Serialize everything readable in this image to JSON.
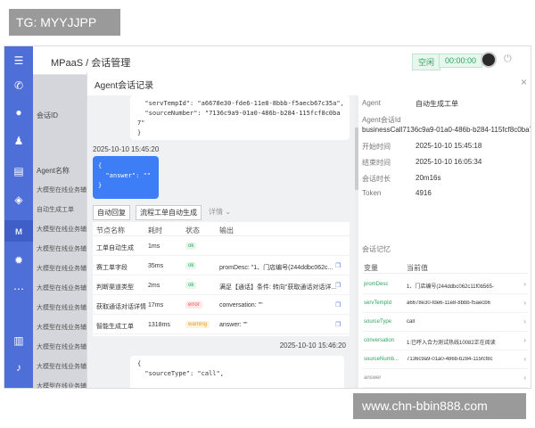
{
  "watermark_tag": "TG: MYYJJPP",
  "watermark_url": "www.chn-bbin888.com",
  "header": {
    "breadcrumb": "MPaaS / 会话管理",
    "status_idle": "空闲",
    "timer": "00:00:00"
  },
  "rail_icons": [
    "menu-icon",
    "phone-icon",
    "chat-icon",
    "user-icon",
    "clipboard-icon",
    "shield-icon",
    "agents-icon",
    "gear-icon",
    "more-icon",
    "book-icon",
    "bell-icon"
  ],
  "bg_list": {
    "title": "Agent名称",
    "rows": [
      "大模型在线业务辅",
      "自动生成工单",
      "大模型在线业务辅",
      "大模型在线业务辅",
      "大模型在线业务辅",
      "大模型在线业务辅",
      "大模型在线业务辅",
      "大模型在线业务辅",
      "大模型在线业务辅",
      "大模型在线业务辅",
      "大模型在线业务辅"
    ],
    "side_label": "会话ID"
  },
  "modal": {
    "title": "Agent会话记录",
    "close": "×"
  },
  "chat": {
    "top_code": "  \"servTempId\": \"a6678e30-fde6-11e8-8bbb-f5aecb67c35a\",\n  \"sourceNumber\": \"7136c9a9-01a0-486b-b284-115fcf8c0ba\n7\"\n}",
    "ts1": "2025-10-10 15:45:20",
    "bubble": "{\n  \"answer\": \"\"\n}",
    "btn_auto_reply": "自动回复",
    "btn_flow": "流程工单自动生成",
    "details": "详情 ⌄",
    "table_head": [
      "节点名称",
      "耗时",
      "状态",
      "输出"
    ],
    "nodes": [
      {
        "name": "工单自动生成",
        "time": "1ms",
        "status": "ok",
        "output": ""
      },
      {
        "name": "赛工单字段",
        "time": "35ms",
        "status": "ok",
        "output": "promDesc: \"1、门店编号(244ddbc062c..."
      },
      {
        "name": "判断渠道类型",
        "time": "2ms",
        "status": "ok",
        "output": "满足【通话】条件: 转向\"获取通话对话详..."
      },
      {
        "name": "获取通话对话详情",
        "time": "17ms",
        "status": "error",
        "output": "conversation: \"\""
      },
      {
        "name": "智能生成工单",
        "time": "1318ms",
        "status": "warning",
        "output": "answer: \"\""
      }
    ],
    "ts2": "2025-10-10 15:46:20",
    "bottom_code": "{\n  \"sourceType\": \"call\","
  },
  "info": {
    "agent_label": "Agent",
    "agent_value": "自动生成工单",
    "session_id_label": "Agent会话Id",
    "session_id_value": "businessCall7136c9a9-01a0-486b-b284-115fcf8c0ba7",
    "start_label": "开始时间",
    "start_value": "2025-10-10 15:45:18",
    "end_label": "结束时间",
    "end_value": "2025-10-10 16:05:34",
    "duration_label": "会话时长",
    "duration_value": "20m16s",
    "token_label": "Token",
    "token_value": "4916",
    "section_title": "会话记忆",
    "vars_head": [
      "变量",
      "当前值"
    ],
    "vars": [
      {
        "name": "promDesc",
        "value": "1、门店编号(244ddbc062c11f0b565-"
      },
      {
        "name": "servTempId",
        "value": "a6678e30-fde6-11e8-8bbb-f5aecb6"
      },
      {
        "name": "sourceType",
        "value": "call"
      },
      {
        "name": "conversation",
        "value": "1:已呼入合力测试热线10082正在阅读"
      },
      {
        "name": "sourceNumb...",
        "value": "7136c9a9-01a0-486b-b284-115fcf8c"
      },
      {
        "name": "answer",
        "value": ""
      }
    ]
  }
}
